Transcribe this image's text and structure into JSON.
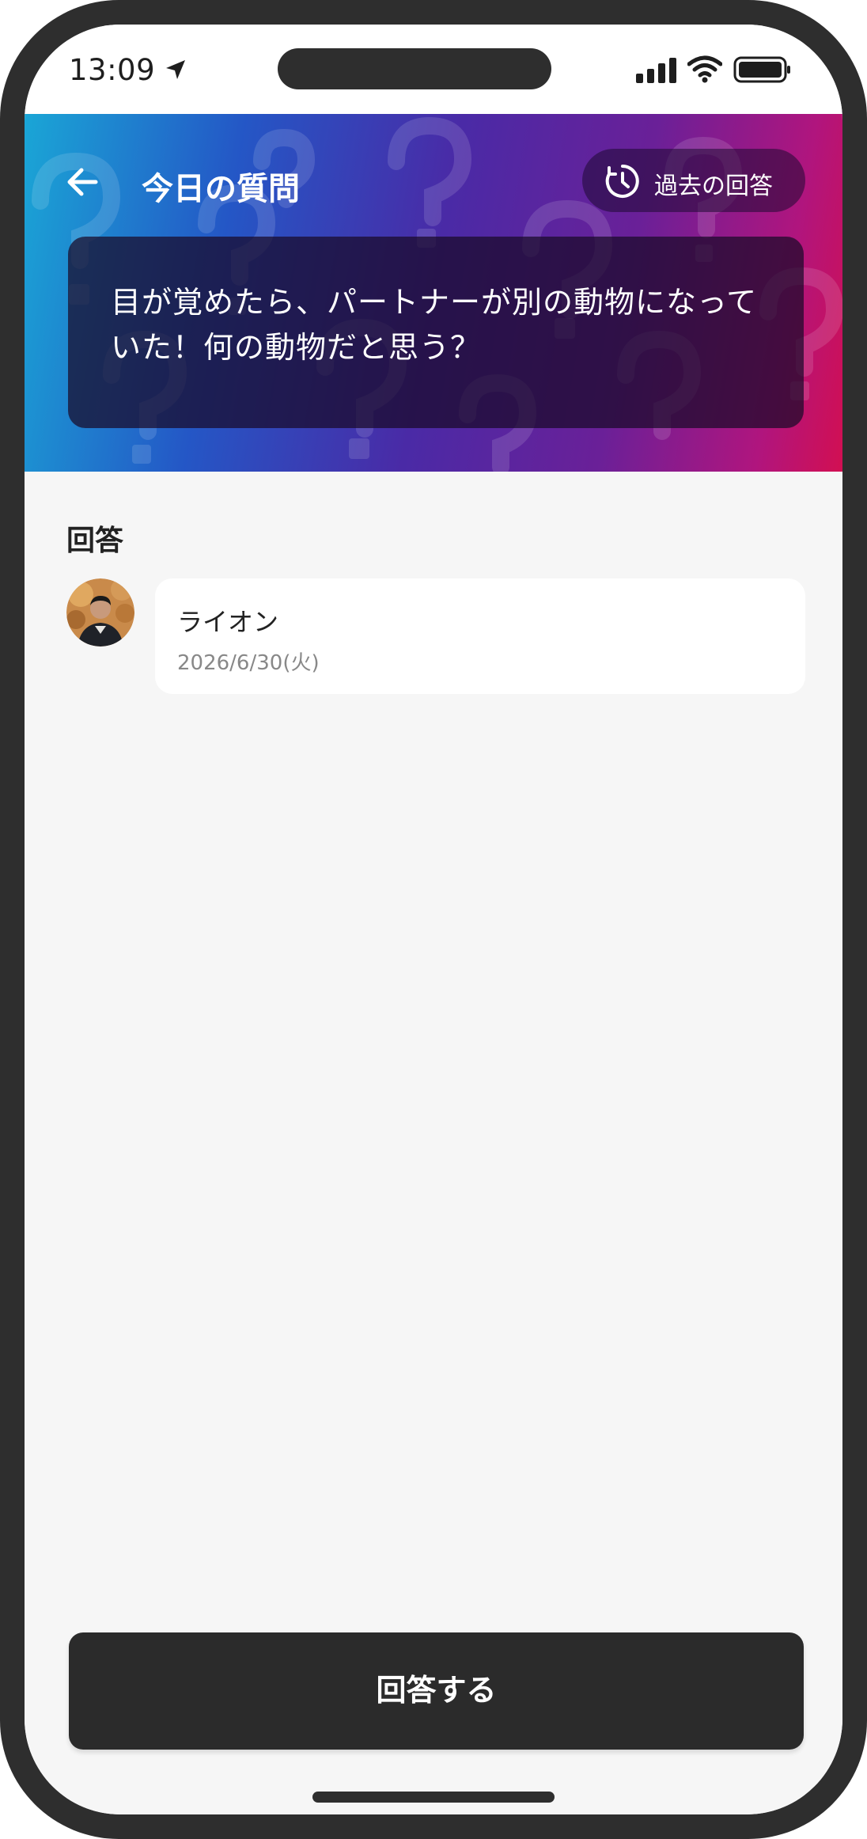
{
  "status_bar": {
    "time": "13:09",
    "icons": [
      "location-arrow-icon",
      "signal-icon",
      "wifi-icon",
      "battery-icon"
    ]
  },
  "header": {
    "title": "今日の質問",
    "history_button_label": "過去の回答",
    "back_icon": "arrow-left-icon",
    "history_icon": "history-clock-icon"
  },
  "question": {
    "text": "目が覚めたら、パートナーが別の動物になっていた！何の動物だと思う？"
  },
  "answers": {
    "section_label": "回答",
    "items": [
      {
        "text": "ライオン",
        "date": "2026/6/30(火)"
      }
    ]
  },
  "footer": {
    "answer_button_label": "回答する"
  },
  "colors": {
    "primary_dark": "#2b2b2b",
    "background": "#f6f6f6",
    "card": "#ffffff",
    "gradient": [
      "#1aa6d6",
      "#2457c6",
      "#4a2aa6",
      "#6a2098",
      "#b0157e",
      "#d20f52"
    ]
  }
}
